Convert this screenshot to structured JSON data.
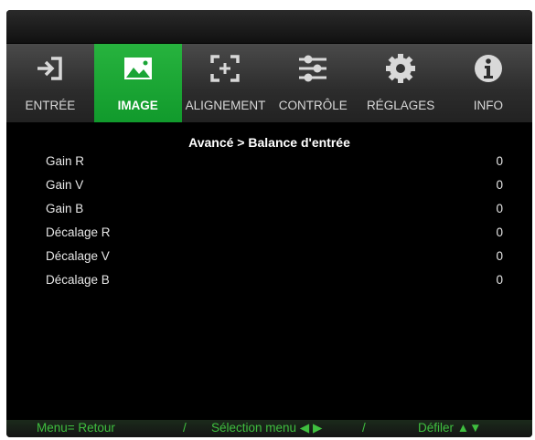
{
  "tabs": [
    {
      "label": "ENTRÉE",
      "icon": "input-icon"
    },
    {
      "label": "IMAGE",
      "icon": "image-icon"
    },
    {
      "label": "ALIGNEMENT",
      "icon": "alignment-icon"
    },
    {
      "label": "CONTRÔLE",
      "icon": "sliders-icon"
    },
    {
      "label": "RÉGLAGES",
      "icon": "gear-icon"
    },
    {
      "label": "INFO",
      "icon": "info-icon"
    }
  ],
  "active_tab": "IMAGE",
  "breadcrumb": "Avancé > Balance d'entrée",
  "settings": [
    {
      "label": "Gain R",
      "value": "0"
    },
    {
      "label": "Gain V",
      "value": "0"
    },
    {
      "label": "Gain B",
      "value": "0"
    },
    {
      "label": "Décalage R",
      "value": "0"
    },
    {
      "label": "Décalage V",
      "value": "0"
    },
    {
      "label": "Décalage B",
      "value": "0"
    }
  ],
  "footer": {
    "back": "Menu= Retour",
    "sep1": "/",
    "select": "Sélection menu ◀ ▶",
    "sep2": "/",
    "scroll": "Défiler ▲▼"
  },
  "colors": {
    "accent": "#1aa536",
    "footer_text": "#3fbf3f"
  }
}
